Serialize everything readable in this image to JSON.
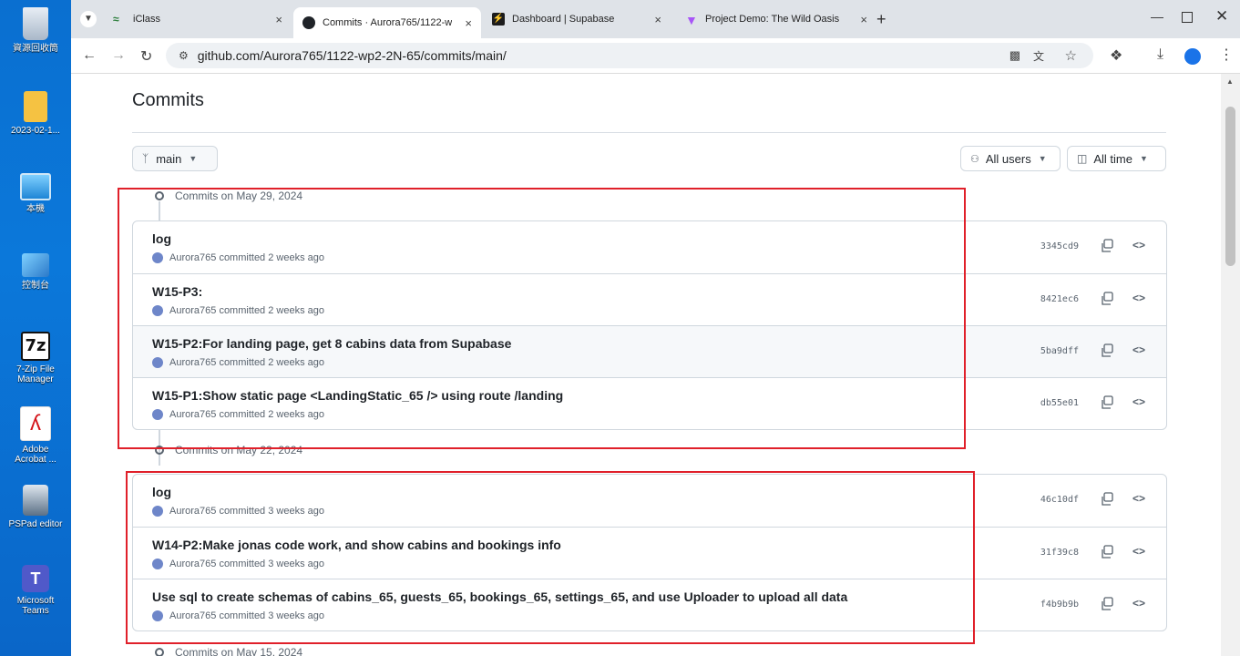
{
  "desktop": {
    "icons": [
      {
        "label": "資源回收筒",
        "icon": "recycle-bin-icon"
      },
      {
        "label": "2023-02-1...",
        "icon": "folder-icon"
      },
      {
        "label": "本機",
        "icon": "computer-icon"
      },
      {
        "label": "控制台",
        "icon": "control-panel-icon"
      },
      {
        "label": "7-Zip File Manager",
        "icon": "7zip-icon"
      },
      {
        "label": "Adobe Acrobat ...",
        "icon": "acrobat-icon"
      },
      {
        "label": "PSPad editor",
        "icon": "pspad-icon"
      },
      {
        "label": "Microsoft Teams",
        "icon": "teams-icon"
      }
    ]
  },
  "browser": {
    "tabs": [
      {
        "title": "iClass",
        "close": "×"
      },
      {
        "title": "Commits · Aurora765/1122-w",
        "close": "×"
      },
      {
        "title": "Dashboard | Supabase",
        "close": "×"
      },
      {
        "title": "Project Demo: The Wild Oasis",
        "close": "×"
      }
    ],
    "new_tab": "+",
    "url": "github.com/Aurora765/1122-wp2-2N-65/commits/main/"
  },
  "page": {
    "title": "Commits",
    "branch": "main",
    "users_filter": "All users",
    "time_filter": "All time"
  },
  "groups": [
    {
      "date": "Commits on May 29, 2024",
      "commits": [
        {
          "message": "log",
          "author": "Aurora765",
          "time": "committed 2 weeks ago",
          "sha": "3345cd9"
        },
        {
          "message": "W15-P3:",
          "author": "Aurora765",
          "time": "committed 2 weeks ago",
          "sha": "8421ec6"
        },
        {
          "message": "W15-P2:For landing page, get 8 cabins data from Supabase",
          "author": "Aurora765",
          "time": "committed 2 weeks ago",
          "sha": "5ba9dff"
        },
        {
          "message": "W15-P1:Show static page <LandingStatic_65 /> using route /landing",
          "author": "Aurora765",
          "time": "committed 2 weeks ago",
          "sha": "db55e01"
        }
      ]
    },
    {
      "date": "Commits on May 22, 2024",
      "commits": [
        {
          "message": "log",
          "author": "Aurora765",
          "time": "committed 3 weeks ago",
          "sha": "46c10df"
        },
        {
          "message": "W14-P2:Make jonas code work, and show cabins and bookings info",
          "author": "Aurora765",
          "time": "committed 3 weeks ago",
          "sha": "31f39c8"
        },
        {
          "message": "Use sql to create schemas of cabins_65, guests_65, bookings_65, settings_65, and use Uploader to upload all data",
          "author": "Aurora765",
          "time": "committed 3 weeks ago",
          "sha": "f4b9b9b"
        }
      ]
    },
    {
      "date": "Commits on May 15, 2024",
      "commits": []
    }
  ],
  "colors": {
    "highlight_box": "#e0202a",
    "accent": "#0969da"
  }
}
